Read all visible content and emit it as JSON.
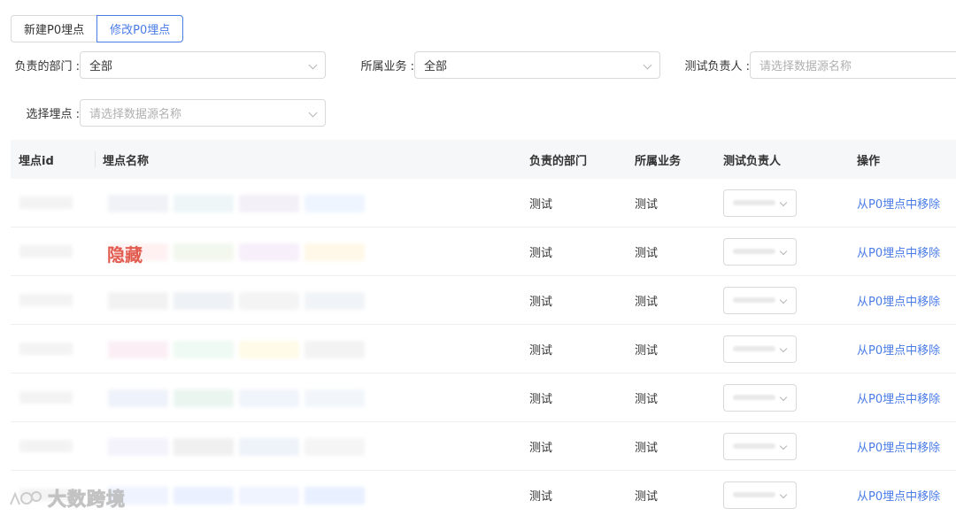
{
  "tabs": [
    {
      "label": "新建P0埋点",
      "active": false
    },
    {
      "label": "修改P0埋点",
      "active": true
    }
  ],
  "filters": {
    "department": {
      "label": "负责的部门 :",
      "value": "全部"
    },
    "business": {
      "label": "所属业务 :",
      "value": "全部"
    },
    "tester": {
      "label": "测试负责人 :",
      "placeholder": "请选择数据源名称"
    },
    "point": {
      "label": "选择埋点 :",
      "placeholder": "请选择数据源名称"
    }
  },
  "table": {
    "columns": [
      "埋点id",
      "埋点名称",
      "负责的部门",
      "所属业务",
      "测试负责人",
      "操作"
    ],
    "hidden_label": "隐藏",
    "rows": [
      {
        "department": "测试",
        "business": "测试",
        "action": "从P0埋点中移除"
      },
      {
        "department": "测试",
        "business": "测试",
        "action": "从P0埋点中移除"
      },
      {
        "department": "测试",
        "business": "测试",
        "action": "从P0埋点中移除"
      },
      {
        "department": "测试",
        "business": "测试",
        "action": "从P0埋点中移除"
      },
      {
        "department": "测试",
        "business": "测试",
        "action": "从P0埋点中移除"
      },
      {
        "department": "测试",
        "business": "测试",
        "action": "从P0埋点中移除"
      },
      {
        "department": "测试",
        "business": "测试",
        "action": "从P0埋点中移除"
      }
    ]
  },
  "watermark": {
    "text": "大数跨境"
  },
  "colors": {
    "accent": "#4a7ce8",
    "hidden": "#e25b4f",
    "header_bg": "#f6f7f9"
  },
  "icons": [
    "chevron-down-icon",
    "watermark-logo-icon"
  ]
}
